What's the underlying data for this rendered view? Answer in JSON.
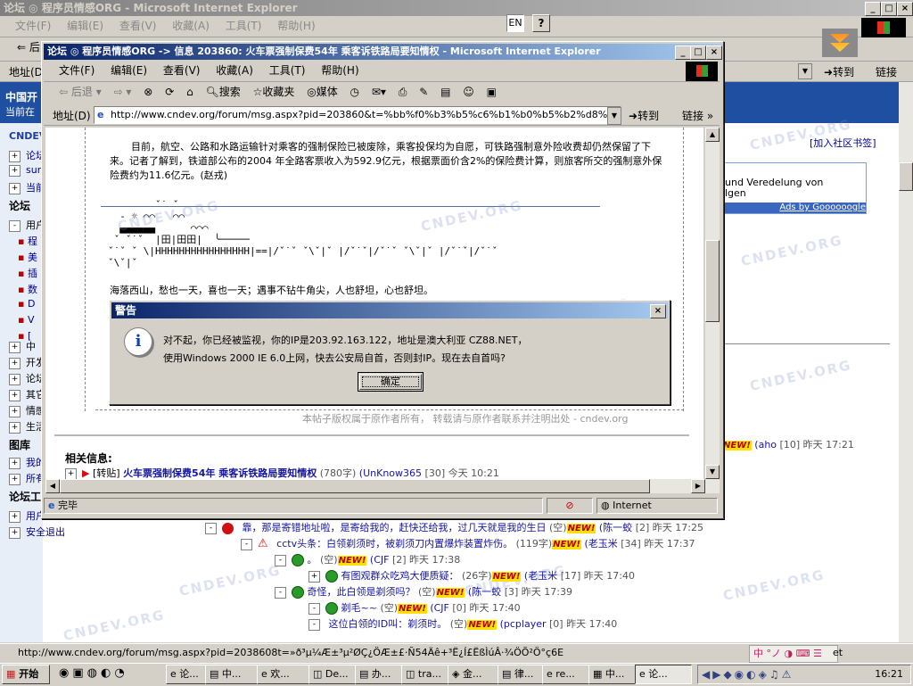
{
  "back_window": {
    "title": "论坛 ◎ 程序员情感ORG - Microsoft Internet Explorer",
    "menu": [
      "文件(F)",
      "编辑(E)",
      "查看(V)",
      "收藏(A)",
      "工具(T)",
      "帮助(H)"
    ],
    "address_label": "地址(D)",
    "go_label": "转到",
    "links_label": "链接",
    "left_banner_title": "中国开",
    "left_banner_sub": "当前在",
    "add_bookmark": "[加入社区书签]",
    "ad_line1": "und Veredelung von",
    "ad_line2": "lgen",
    "ad_footer": "Ads by Goooooogle",
    "sidebar": {
      "logo": "CNDEV",
      "items_top": [
        "论坛",
        "sum",
        "当前"
      ],
      "section_forum": "论坛",
      "forum_items": [
        "用户",
        "程",
        "美",
        "插",
        "数",
        "D",
        "V",
        "["
      ],
      "forum_items2": [
        "中",
        "开发",
        "论坛",
        "其它",
        "情感",
        "生活"
      ],
      "section_pics": "图库",
      "pic_items": [
        "我的",
        "所有"
      ],
      "section_tools": "论坛工",
      "tool_items": [
        "用户...",
        "安全退出"
      ]
    },
    "threads": [
      {
        "title": "靠，那是寄错地址啦，是寄给我的，赶快还给我，过几天就是我的生日",
        "size": "(空)",
        "author": "陈一蛟",
        "count": "[2]",
        "time": "昨天 17:25"
      },
      {
        "title": "cctv头条：白领剃须时，被剃须刀内置爆炸装置炸伤。",
        "size": "(119字)",
        "author": "老玉米",
        "count": "[34]",
        "time": "昨天 17:37"
      },
      {
        "title": "。",
        "size": "(空)",
        "author": "CJF",
        "count": "[2]",
        "time": "昨天 17:38"
      },
      {
        "title": "有图观群众吃鸡大便质疑：",
        "size": "(26字)",
        "author": "老玉米",
        "count": "[17]",
        "time": "昨天 17:40"
      },
      {
        "title": "奇怪，此白领是剃须吗？",
        "size": "(空)",
        "author": "陈一蛟",
        "count": "[3]",
        "time": "昨天 17:39"
      },
      {
        "title": "剃毛~~",
        "size": "(空)",
        "author": "CJF",
        "count": "[0]",
        "time": "昨天 17:40"
      },
      {
        "title": "这位白领的ID叫：剃须时。",
        "size": "(空)",
        "author": "pcplayer",
        "count": "[0]",
        "time": "昨天 17:40"
      }
    ],
    "right_entry": {
      "new": "NEW!",
      "author": "aho",
      "count": "[10]",
      "time": "昨天 17:21"
    },
    "new_badge": "NEW!",
    "status_url": "http://www.cndev.org/forum/msg.aspx?pid=2038608t=»ð³µ¼Æ±³µ²ØÇ¿ÖÆ±£·Ñ54Äê+³Ë¿Í£ËßÌúÂ·¾ÖÕ²Ö°ç6E",
    "watermark": "CNDEV.ORG"
  },
  "front_window": {
    "title": "论坛 ◎ 程序员情感ORG -> 信息 203860: 火车票强制保费54年 乘客诉铁路局要知情权 - Microsoft Internet Explorer",
    "menu": [
      "文件(F)",
      "编辑(E)",
      "查看(V)",
      "收藏(A)",
      "工具(T)",
      "帮助(H)"
    ],
    "toolbar": {
      "back": "后退",
      "search": "搜索",
      "favorites": "收藏夹",
      "media": "媒体"
    },
    "address_label": "地址(D)",
    "url": "http://www.cndev.org/forum/msg.aspx?pid=203860&t=%bb%f0%b3%b5%c6%b1%b0%b5%b2%d8%c7%bf%",
    "go_label": "转到",
    "links_label": "链接",
    "article_text": "目前，航空、公路和水路运输针对乘客的强制保险已被废除，乘客投保均为自愿，可铁路强制意外险收费却仍然保留了下来。记者了解到，铁道部公布的2004 年全路客票收入为592.9亿元，根据票面价含2%的保险费计算，则旅客所交的强制意外保险费约为11.6亿元。(赵戎)",
    "ascii_art": "        ˇ˙ ˇ\n  - ☼ ⌒⌒   ⌒⌒\n  ▄▄▄▄▄▄      ⌒⌒⌒\n ˇ ˇ˙ˇ  |田|田田|  ╰─────\nˇ˙ˇ ˇ \\|HHHHHHHHHHHHHHHH|==|/ˇ˙ˇ ˇ\\ˇ|ˇ |/ˇ˙ˇ|/ˇ˙ˇ ˇ\\ˇ|ˇ |/ˇ˙ˇ|/ˇ˙ˇ\nˇ\\ˇ|ˇ",
    "signature": "海落西山，愁也一天，喜也一天；遇事不钻牛角尖，人也舒坦，心也舒坦。",
    "copyright": "本帖子版权属于原作者所有， 转载请与原作者联系并注明出处 - cndev.org",
    "related_title": "相关信息:",
    "related_item": {
      "tag": "[转贴]",
      "title": "火车票强制保费54年 乘客诉铁路局要知情权",
      "size": "(780字)",
      "author": "UnKnow365",
      "count": "[30]",
      "time": "今天 10:21"
    },
    "status_text": "完毕",
    "zone": "Internet"
  },
  "dialog": {
    "title": "警告",
    "line1": "对不起，你已经被监视，你的IP是203.92.163.122，地址是澳大利亚  CZ88.NET，",
    "line2": "使用Windows 2000 IE 6.0上网，快去公安局自首，否则封IP。现在去自首吗?",
    "ok": "确定"
  },
  "system": {
    "lang": "EN",
    "help": "?",
    "start": "开始",
    "clock": "16:21",
    "tasks": [
      "论...",
      "中...",
      "欢...",
      "De...",
      "办...",
      "tra...",
      "金...",
      "律...",
      "re...",
      "中...",
      "论..."
    ]
  },
  "colors": {
    "title_active": "#0a246a",
    "link": "#00008b",
    "accent_red": "#c00000"
  }
}
